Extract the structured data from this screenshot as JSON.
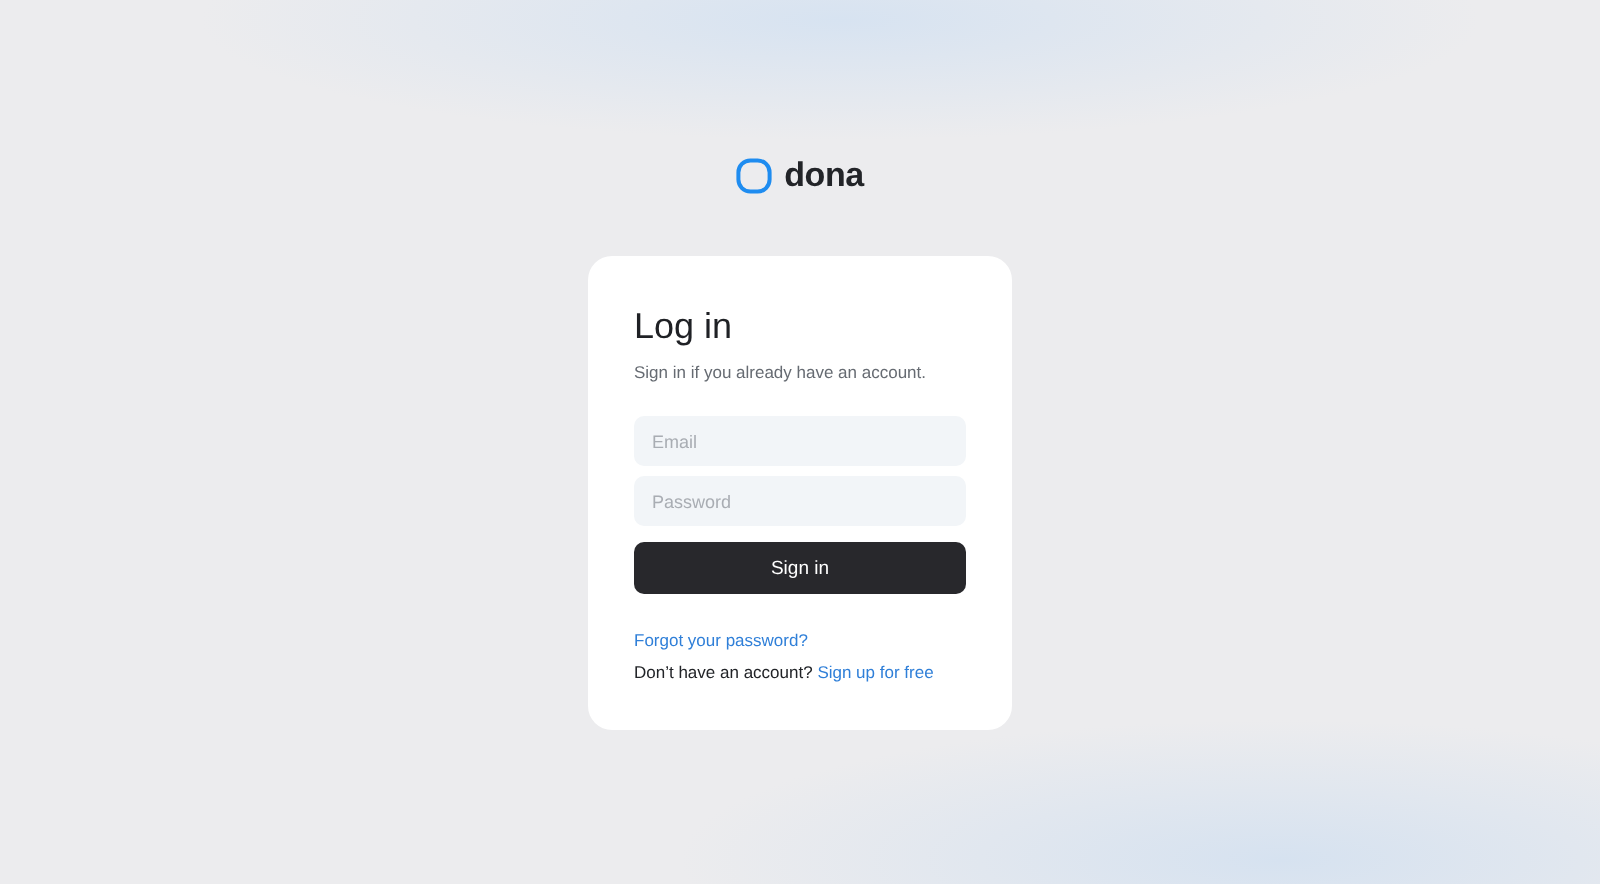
{
  "brand": {
    "name": "dona"
  },
  "login": {
    "title": "Log in",
    "subtitle": "Sign in if you already have an account.",
    "fields": [
      {
        "placeholder": "Email"
      },
      {
        "placeholder": "Password"
      }
    ],
    "submit": "Sign in",
    "forgot_link": "Forgot your password?",
    "signup": {
      "prompt": "Don’t have an account?",
      "link": "Sign up for free"
    }
  }
}
